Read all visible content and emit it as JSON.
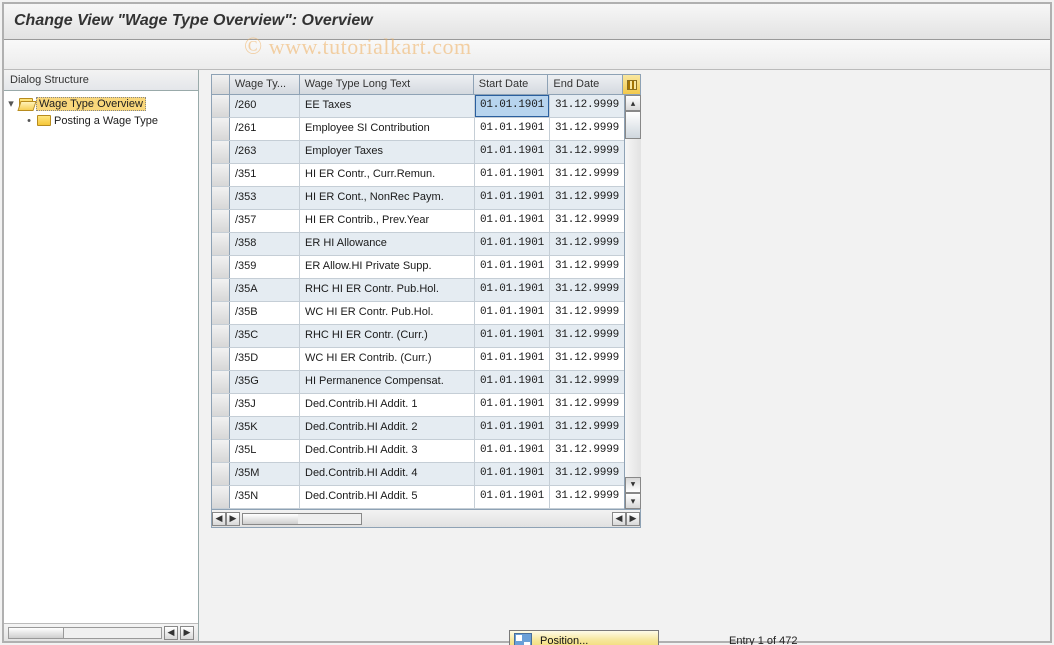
{
  "title": "Change View \"Wage Type Overview\": Overview",
  "watermark": "www.tutorialkart.com",
  "sidebar": {
    "header": "Dialog Structure",
    "items": [
      {
        "label": "Wage Type Overview",
        "selected": true,
        "expanded": true,
        "level": 0
      },
      {
        "label": "Posting a Wage Type",
        "selected": false,
        "expanded": false,
        "level": 1
      }
    ]
  },
  "grid": {
    "columns": {
      "wage_type": "Wage Ty...",
      "long_text": "Wage Type Long Text",
      "start_date": "Start Date",
      "end_date": "End Date"
    },
    "rows": [
      {
        "wt": "/260",
        "lt": "EE Taxes",
        "sd": "01.01.1901",
        "ed": "31.12.9999",
        "sd_selected": true
      },
      {
        "wt": "/261",
        "lt": "Employee SI Contribution",
        "sd": "01.01.1901",
        "ed": "31.12.9999"
      },
      {
        "wt": "/263",
        "lt": "Employer Taxes",
        "sd": "01.01.1901",
        "ed": "31.12.9999"
      },
      {
        "wt": "/351",
        "lt": "HI ER Contr., Curr.Remun.",
        "sd": "01.01.1901",
        "ed": "31.12.9999"
      },
      {
        "wt": "/353",
        "lt": "HI ER Cont., NonRec Paym.",
        "sd": "01.01.1901",
        "ed": "31.12.9999"
      },
      {
        "wt": "/357",
        "lt": "HI ER Contrib., Prev.Year",
        "sd": "01.01.1901",
        "ed": "31.12.9999"
      },
      {
        "wt": "/358",
        "lt": "ER HI Allowance",
        "sd": "01.01.1901",
        "ed": "31.12.9999"
      },
      {
        "wt": "/359",
        "lt": "ER Allow.HI Private Supp.",
        "sd": "01.01.1901",
        "ed": "31.12.9999"
      },
      {
        "wt": "/35A",
        "lt": "RHC HI ER Contr. Pub.Hol.",
        "sd": "01.01.1901",
        "ed": "31.12.9999"
      },
      {
        "wt": "/35B",
        "lt": "WC HI ER Contr. Pub.Hol.",
        "sd": "01.01.1901",
        "ed": "31.12.9999"
      },
      {
        "wt": "/35C",
        "lt": "RHC HI ER Contr. (Curr.)",
        "sd": "01.01.1901",
        "ed": "31.12.9999"
      },
      {
        "wt": "/35D",
        "lt": "WC HI ER Contrib. (Curr.)",
        "sd": "01.01.1901",
        "ed": "31.12.9999"
      },
      {
        "wt": "/35G",
        "lt": "HI Permanence Compensat.",
        "sd": "01.01.1901",
        "ed": "31.12.9999"
      },
      {
        "wt": "/35J",
        "lt": "Ded.Contrib.HI Addit. 1",
        "sd": "01.01.1901",
        "ed": "31.12.9999"
      },
      {
        "wt": "/35K",
        "lt": "Ded.Contrib.HI Addit. 2",
        "sd": "01.01.1901",
        "ed": "31.12.9999"
      },
      {
        "wt": "/35L",
        "lt": "Ded.Contrib.HI Addit. 3",
        "sd": "01.01.1901",
        "ed": "31.12.9999"
      },
      {
        "wt": "/35M",
        "lt": "Ded.Contrib.HI Addit. 4",
        "sd": "01.01.1901",
        "ed": "31.12.9999"
      },
      {
        "wt": "/35N",
        "lt": "Ded.Contrib.HI Addit. 5",
        "sd": "01.01.1901",
        "ed": "31.12.9999"
      }
    ]
  },
  "footer": {
    "position_button": "Position...",
    "entry_status": "Entry 1 of 472"
  },
  "glyphs": {
    "tri_right": "▸",
    "tri_down": "▾",
    "tri_up": "▴",
    "bullet": "•",
    "left": "◀",
    "right": "▶"
  }
}
